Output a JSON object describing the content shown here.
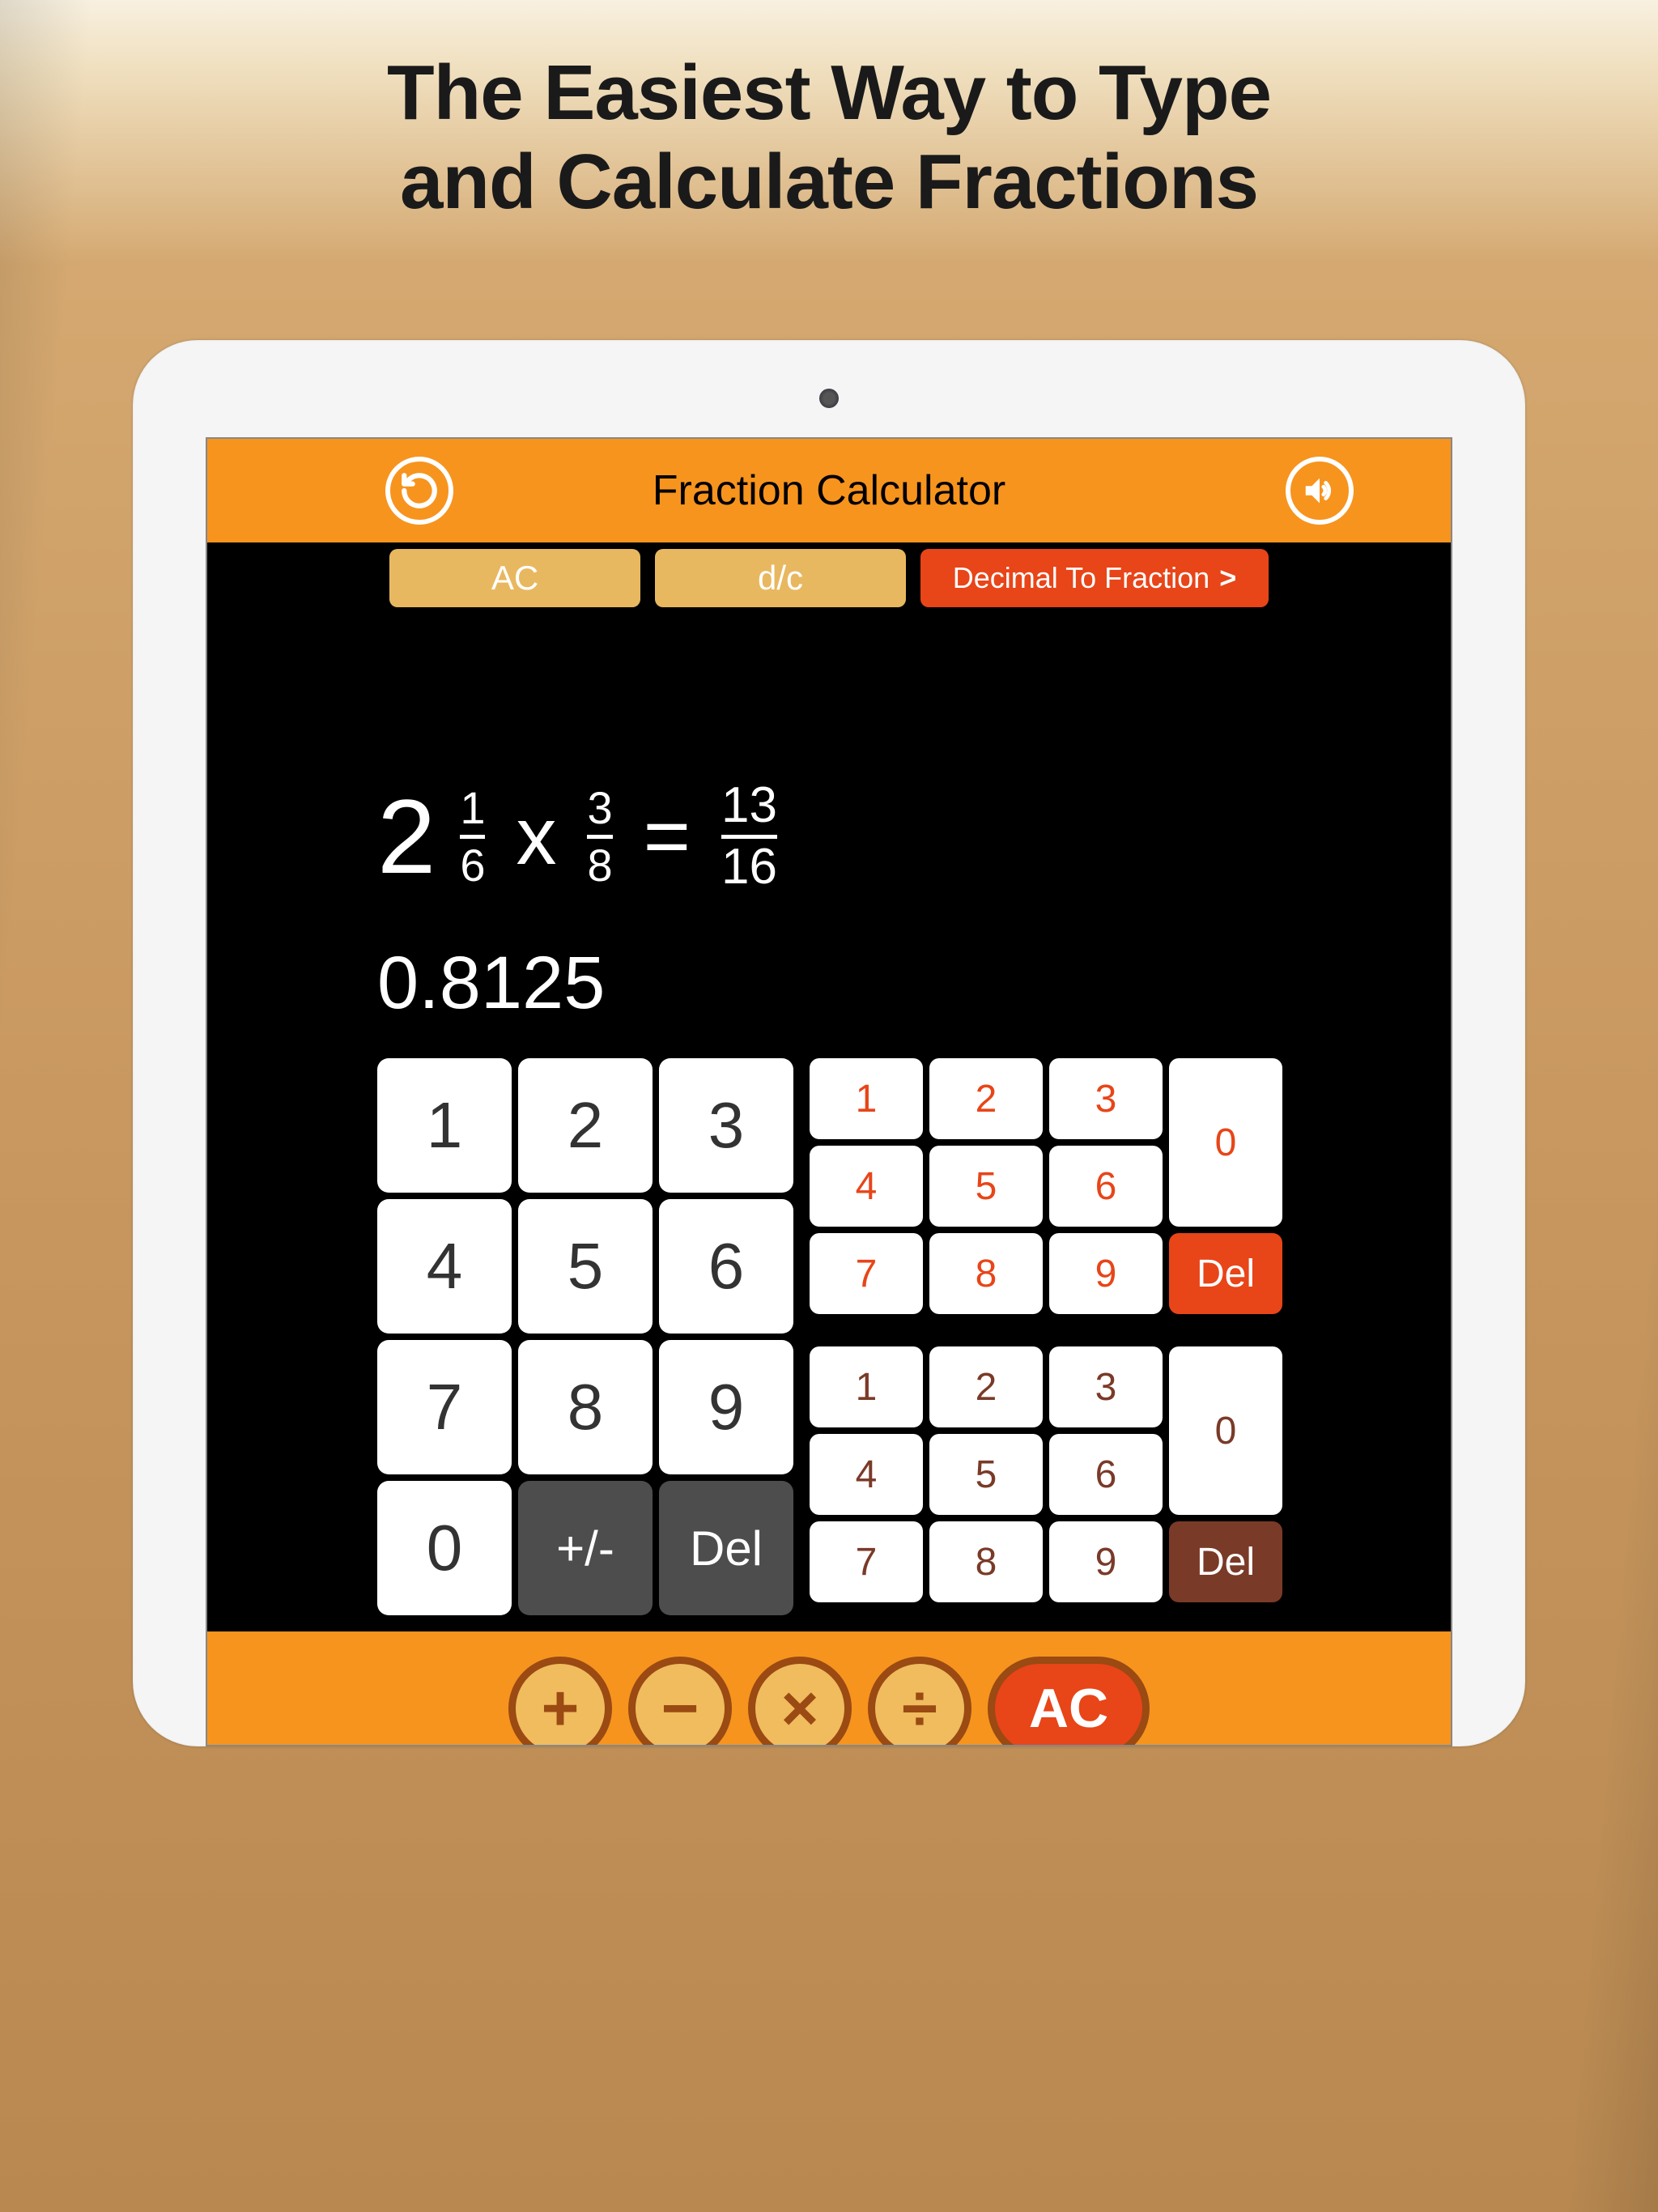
{
  "marketing": {
    "tagline_line1": "The Easiest Way to Type",
    "tagline_line2": "and Calculate Fractions"
  },
  "header": {
    "title": "Fraction Calculator"
  },
  "toolbar": {
    "ac_label": "AC",
    "dc_label": "d/c",
    "dtf_label": "Decimal To Fraction",
    "chevron": ">"
  },
  "equation": {
    "operand1": {
      "whole": "2",
      "num": "1",
      "den": "6"
    },
    "operator": "x",
    "operand2": {
      "num": "3",
      "den": "8"
    },
    "equals": "=",
    "result": {
      "num": "13",
      "den": "16"
    },
    "decimal": "0.8125"
  },
  "main_keypad": [
    "1",
    "2",
    "3",
    "4",
    "5",
    "6",
    "7",
    "8",
    "9",
    "0",
    "+/-",
    "Del"
  ],
  "mini_keypad_top": {
    "row1": [
      "1",
      "2",
      "3"
    ],
    "row2": [
      "4",
      "5",
      "6"
    ],
    "row3": [
      "7",
      "8",
      "9"
    ],
    "zero": "0",
    "del": "Del"
  },
  "mini_keypad_bottom": {
    "row1": [
      "1",
      "2",
      "3"
    ],
    "row2": [
      "4",
      "5",
      "6"
    ],
    "row3": [
      "7",
      "8",
      "9"
    ],
    "zero": "0",
    "del": "Del"
  },
  "operations": {
    "add": "+",
    "subtract": "−",
    "multiply": "×",
    "divide": "÷",
    "ac": "AC"
  }
}
